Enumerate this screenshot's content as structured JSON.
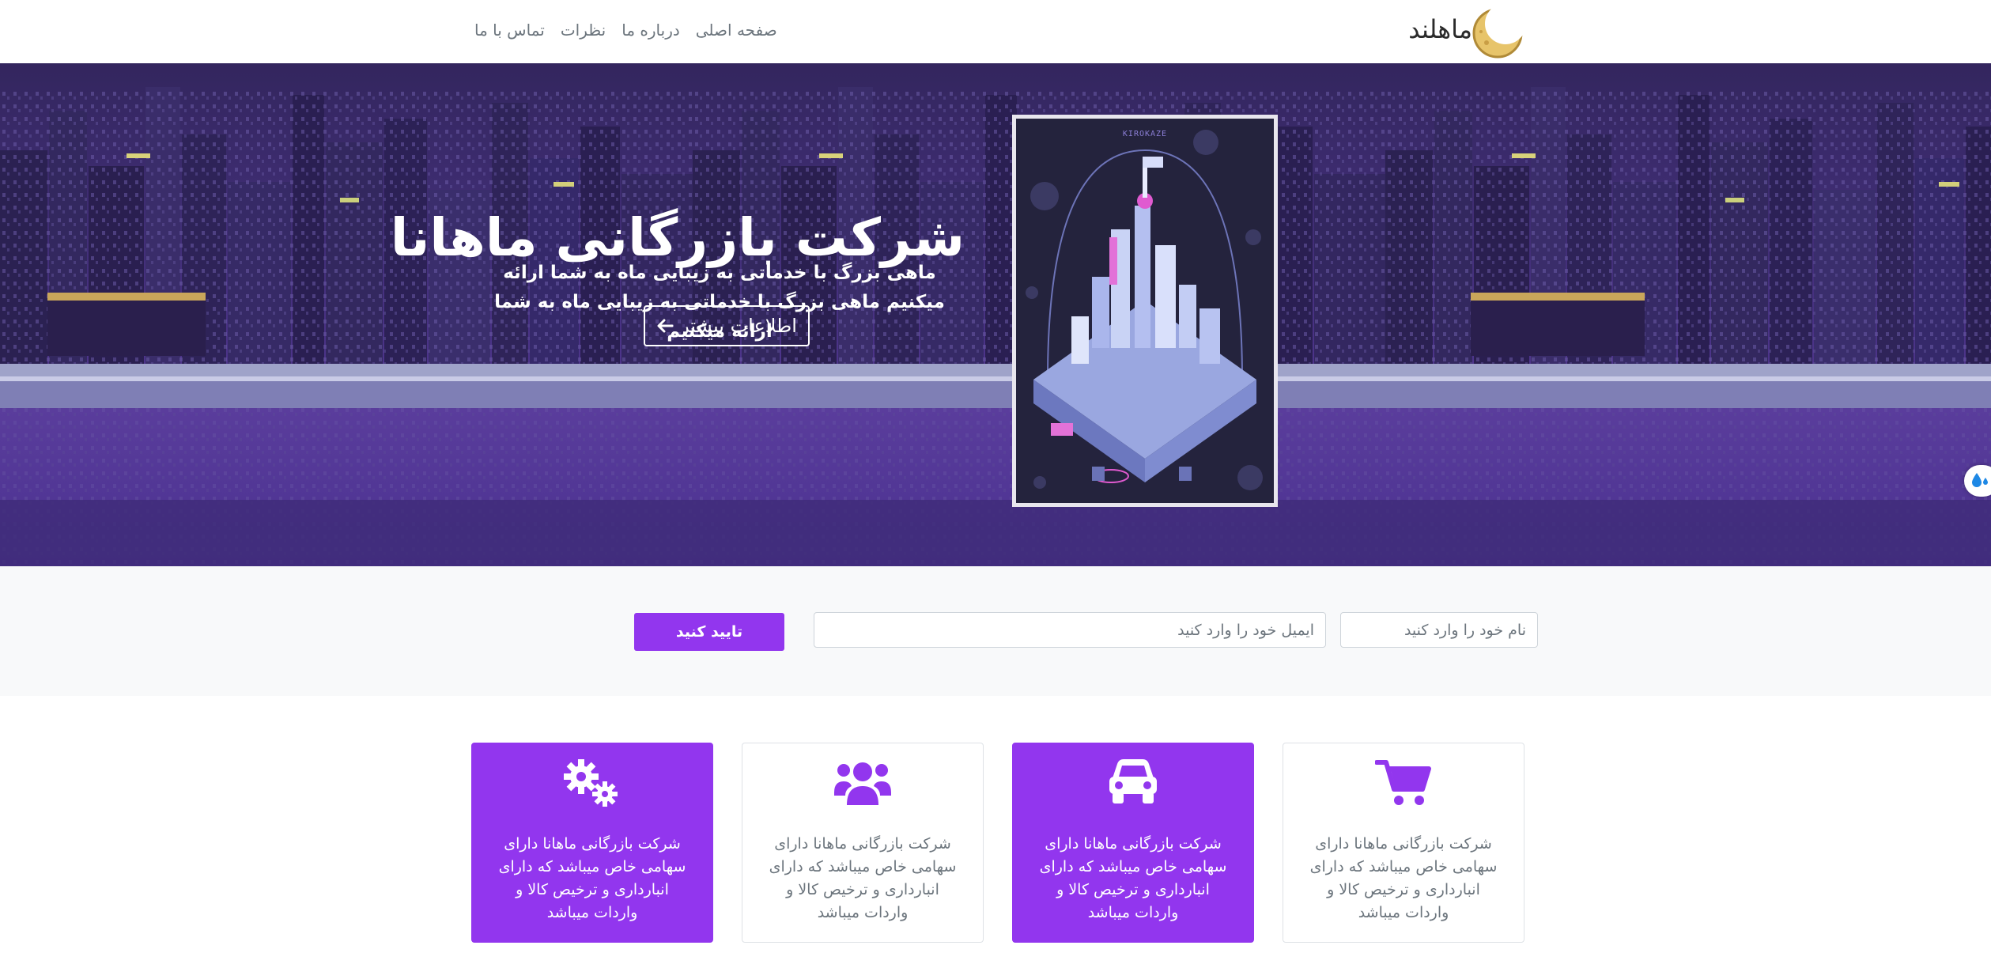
{
  "navbar": {
    "brand": "ماهلند",
    "links": [
      "صفحه اصلی",
      "درباره ما",
      "نظرات",
      "تماس با ما"
    ]
  },
  "hero": {
    "title": "شرکت بازرگانی ماهانا",
    "subtitle": "ماهی بزرگ با خدماتی به زیبایی ماه به شما ارائه میکنیم ماهی بزرگ با خدماتی به زیبایی ماه به شما ارائه میکنیم",
    "button_label": "اطلاعات بیشتر",
    "button_icon": "arrow-left-icon",
    "poster_label": "KIROKAZE"
  },
  "form": {
    "name_placeholder": "نام خود را وارد کنید",
    "email_placeholder": "ایمیل خود را وارد کنید",
    "submit_label": "تایید کنید"
  },
  "features": [
    {
      "icon": "cart-icon",
      "style": "outline",
      "text": "شرکت بازرگانی ماهانا دارای سهامی خاص میباشد که دارای انبارداری و ترخیص کالا و واردات میباشد"
    },
    {
      "icon": "car-icon",
      "style": "filled",
      "text": "شرکت بازرگانی ماهانا دارای سهامی خاص میباشد که دارای انبارداری و ترخیص کالا و واردات میباشد"
    },
    {
      "icon": "users-icon",
      "style": "outline",
      "text": "شرکت بازرگانی ماهانا دارای سهامی خاص میباشد که دارای انبارداری و ترخیص کالا و واردات میباشد"
    },
    {
      "icon": "gears-icon",
      "style": "filled",
      "text": "شرکت بازرگانی ماهانا دارای سهامی خاص میباشد که دارای انبارداری و ترخیص کالا و واردات میباشد"
    }
  ],
  "colors": {
    "accent": "#9236ee",
    "hero_sky": "#3b2a6b",
    "navbar_bg": "#ffffff",
    "form_bg": "#f8f9fa"
  }
}
